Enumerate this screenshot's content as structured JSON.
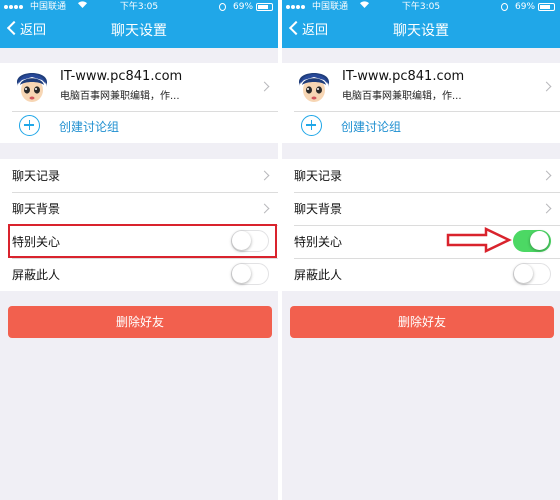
{
  "status_bar": {
    "carrier": "中国联通",
    "time": "下午3:05",
    "battery_pct": "69%",
    "battery_level": 0.69
  },
  "nav": {
    "back_label": "返回",
    "title": "聊天设置"
  },
  "profile": {
    "name": "IT-www.pc841.com",
    "description": "电脑百事网兼职编辑，作..."
  },
  "create_group_label": "创建讨论组",
  "rows": {
    "chat_history": "聊天记录",
    "chat_background": "聊天背景",
    "special_care": "特别关心",
    "block_person": "屏蔽此人"
  },
  "left_screen": {
    "special_care_on": false,
    "block_person_on": false
  },
  "right_screen": {
    "special_care_on": true,
    "block_person_on": false
  },
  "delete_friend_label": "删除好友",
  "colors": {
    "accent": "#20a7e8",
    "delete_button": "#f2604e",
    "toggle_on": "#4cd864",
    "annotation_red": "#d9232d"
  },
  "icons": [
    "back-chevron-icon",
    "plus-circle-icon",
    "chevron-right-icon",
    "wifi-icon",
    "lock-rotation-icon",
    "battery-icon",
    "avatar-cartoon"
  ]
}
